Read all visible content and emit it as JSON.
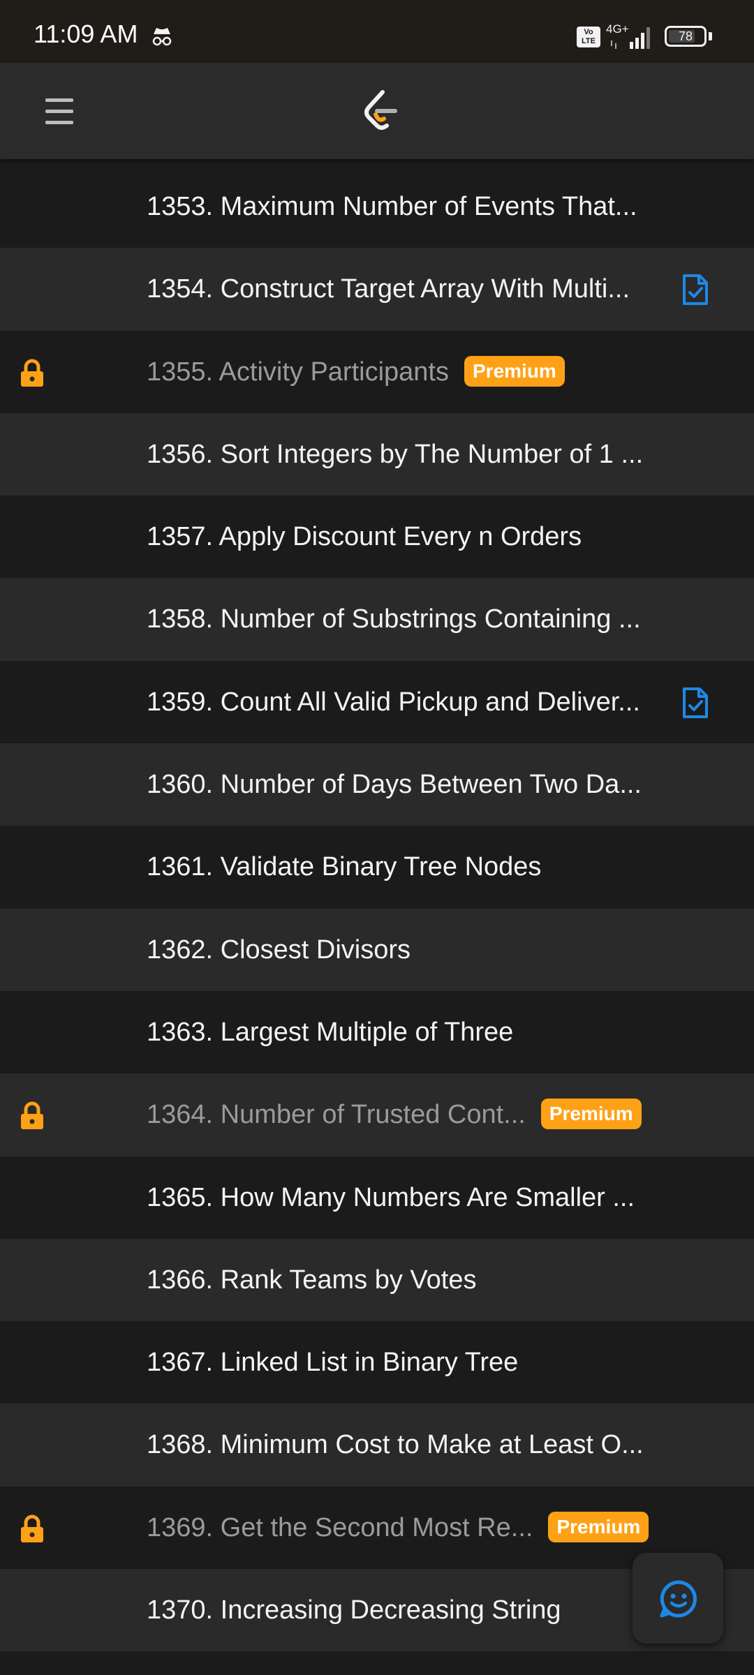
{
  "status_bar": {
    "time": "11:09 AM",
    "volte_label": "Vo LTE",
    "network_label": "4G+",
    "battery_level": "78"
  },
  "header": {
    "menu_icon": "hamburger-menu-icon",
    "logo_icon": "leetcode-logo-icon"
  },
  "colors": {
    "accent_orange": "#ffa116",
    "solved_blue": "#1e88e5",
    "row_dark": "#1b1b1b",
    "row_light": "#2a2a2a"
  },
  "problems": [
    {
      "title": "1353. Maximum Number of Events That...",
      "locked": false,
      "premium": false,
      "solved": false
    },
    {
      "title": "1354. Construct Target Array With Multi...",
      "locked": false,
      "premium": false,
      "solved": true
    },
    {
      "title": "1355. Activity Participants",
      "locked": true,
      "premium": true,
      "premium_label": "Premium",
      "solved": false
    },
    {
      "title": "1356. Sort Integers by The Number of 1 ...",
      "locked": false,
      "premium": false,
      "solved": false
    },
    {
      "title": "1357. Apply Discount Every n Orders",
      "locked": false,
      "premium": false,
      "solved": false
    },
    {
      "title": "1358. Number of Substrings Containing ...",
      "locked": false,
      "premium": false,
      "solved": false
    },
    {
      "title": "1359. Count All Valid Pickup and Deliver...",
      "locked": false,
      "premium": false,
      "solved": true
    },
    {
      "title": "1360. Number of Days Between Two Da...",
      "locked": false,
      "premium": false,
      "solved": false
    },
    {
      "title": "1361. Validate Binary Tree Nodes",
      "locked": false,
      "premium": false,
      "solved": false
    },
    {
      "title": "1362. Closest Divisors",
      "locked": false,
      "premium": false,
      "solved": false
    },
    {
      "title": "1363. Largest Multiple of Three",
      "locked": false,
      "premium": false,
      "solved": false
    },
    {
      "title": "1364. Number of Trusted Cont...",
      "locked": true,
      "premium": true,
      "premium_label": "Premium",
      "solved": false
    },
    {
      "title": "1365. How Many Numbers Are Smaller ...",
      "locked": false,
      "premium": false,
      "solved": false
    },
    {
      "title": "1366. Rank Teams by Votes",
      "locked": false,
      "premium": false,
      "solved": false
    },
    {
      "title": "1367. Linked List in Binary Tree",
      "locked": false,
      "premium": false,
      "solved": false
    },
    {
      "title": "1368. Minimum Cost to Make at Least O...",
      "locked": false,
      "premium": false,
      "solved": false
    },
    {
      "title": "1369. Get the Second Most Re...",
      "locked": true,
      "premium": true,
      "premium_label": "Premium",
      "solved": false
    },
    {
      "title": "1370. Increasing Decreasing String",
      "locked": false,
      "premium": false,
      "solved": false
    }
  ],
  "fab": {
    "icon": "feedback-smiley-icon"
  }
}
